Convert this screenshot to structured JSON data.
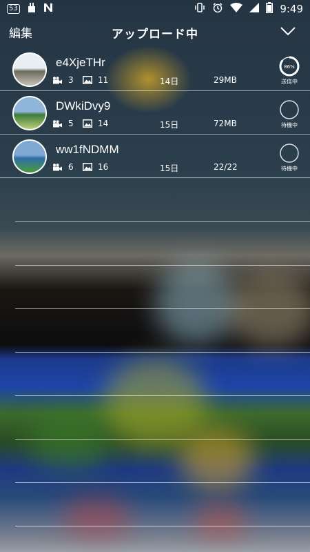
{
  "status_bar": {
    "notification_count": "53",
    "time": "9:49"
  },
  "header": {
    "edit_label": "編集",
    "title": "アップロード中"
  },
  "uploads": [
    {
      "name": "e4XjeTHr",
      "videos": "3",
      "photos": "11",
      "date": "14日",
      "size": "29MB",
      "progress_label": "86%",
      "progress": 0.86,
      "status": "送信中",
      "thumb_colors": [
        "#e8eef2",
        "#6d6a5e",
        "#c7c2b5"
      ]
    },
    {
      "name": "DWkiDvy9",
      "videos": "5",
      "photos": "14",
      "date": "15日",
      "size": "72MB",
      "progress_label": "",
      "progress": 0,
      "status": "待機中",
      "thumb_colors": [
        "#8fb6d8",
        "#3d7b3a",
        "#bcd07a"
      ]
    },
    {
      "name": "ww1fNDMM",
      "videos": "6",
      "photos": "16",
      "date": "15日",
      "size": "22/22",
      "progress_label": "",
      "progress": 0,
      "status": "待機中",
      "thumb_colors": [
        "#7fa8d2",
        "#2e6fa6",
        "#4b9a3c"
      ]
    }
  ]
}
